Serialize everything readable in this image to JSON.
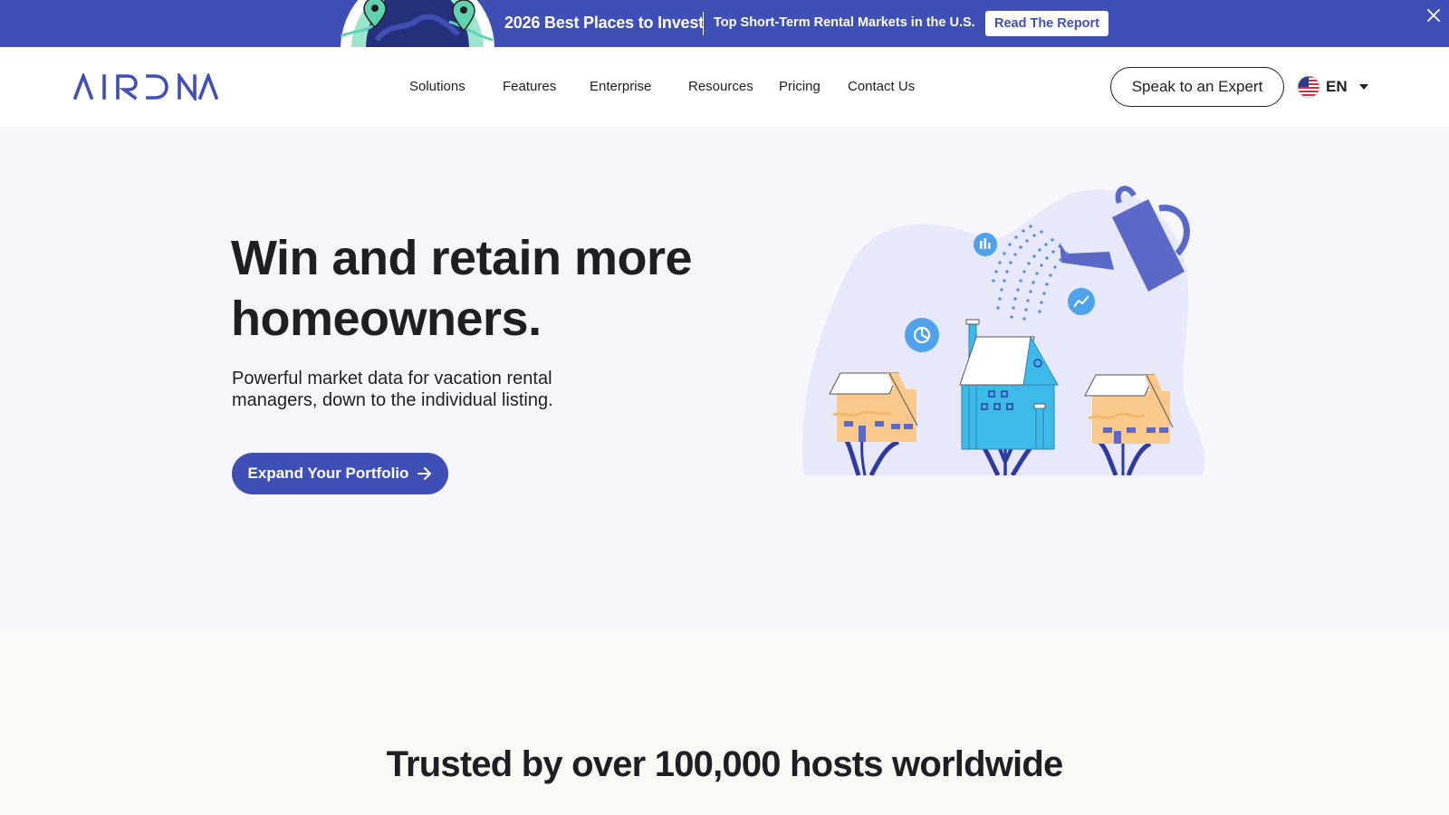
{
  "banner": {
    "title": "2026 Best Places to Invest",
    "subtitle": "Top Short-Term Rental Markets in the U.S.",
    "cta": "Read The Report"
  },
  "nav": {
    "logo": "AIRDNA",
    "items": [
      "Solutions",
      "Features",
      "Enterprise",
      "Resources",
      "Pricing",
      "Contact Us"
    ],
    "speak_button": "Speak to an Expert",
    "language": "EN"
  },
  "hero": {
    "title": "Win and retain more homeowners.",
    "subtitle": "Powerful market data for vacation rental managers, down to the individual listing.",
    "cta": "Expand Your Portfolio"
  },
  "trusted": {
    "title": "Trusted by over 100,000 hosts worldwide"
  },
  "colors": {
    "brand": "#3f4fb5",
    "hero_bg": "#f6f6fb",
    "page_bg": "#faf9f6",
    "house_yellow": "#f8c98a",
    "house_blue": "#3dbbe8"
  },
  "icons": [
    "globe-icon",
    "close-icon",
    "flag-us-icon",
    "caret-down-icon",
    "arrow-right-icon",
    "watering-can-icon",
    "pie-chart-icon",
    "line-chart-icon",
    "bar-chart-icon"
  ]
}
